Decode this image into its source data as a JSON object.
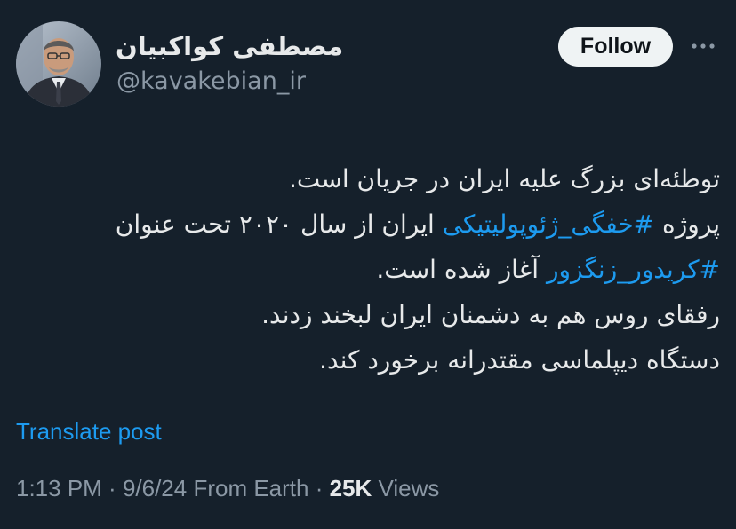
{
  "author": {
    "display_name": "مصطفی کواکبیان",
    "handle": "@kavakebian_ir"
  },
  "actions": {
    "follow_label": "Follow",
    "more_icon": "more-horizontal-icon"
  },
  "tweet": {
    "line1": "توطئه‌ای بزرگ علیه ایران در جریان است.",
    "line2_text": "پروژه ",
    "line2_hashtag": "#خفگی_ژئوپولیتیکی",
    "line2_rest": " ایران از سال ۲۰۲۰ تحت عنوان",
    "line3_hashtag": "#کریدور_زنگزور",
    "line3_rest": " آغاز شده است.",
    "line4": "رفقای روس هم به دشمنان ایران لبخند زدند.",
    "line5": "دستگاه دیپلماسی مقتدرانه برخورد کند."
  },
  "translate_label": "Translate post",
  "meta": {
    "time": "1:13 PM",
    "sep1": " · ",
    "date": "9/6/24",
    "source": " From Earth",
    "sep2": " · ",
    "views_count": "25K",
    "views_label": " Views"
  },
  "colors": {
    "background": "#15202b",
    "text": "#e7e9ea",
    "secondary": "#8b98a5",
    "link": "#1d9bf0",
    "button_bg": "#eff3f4"
  }
}
